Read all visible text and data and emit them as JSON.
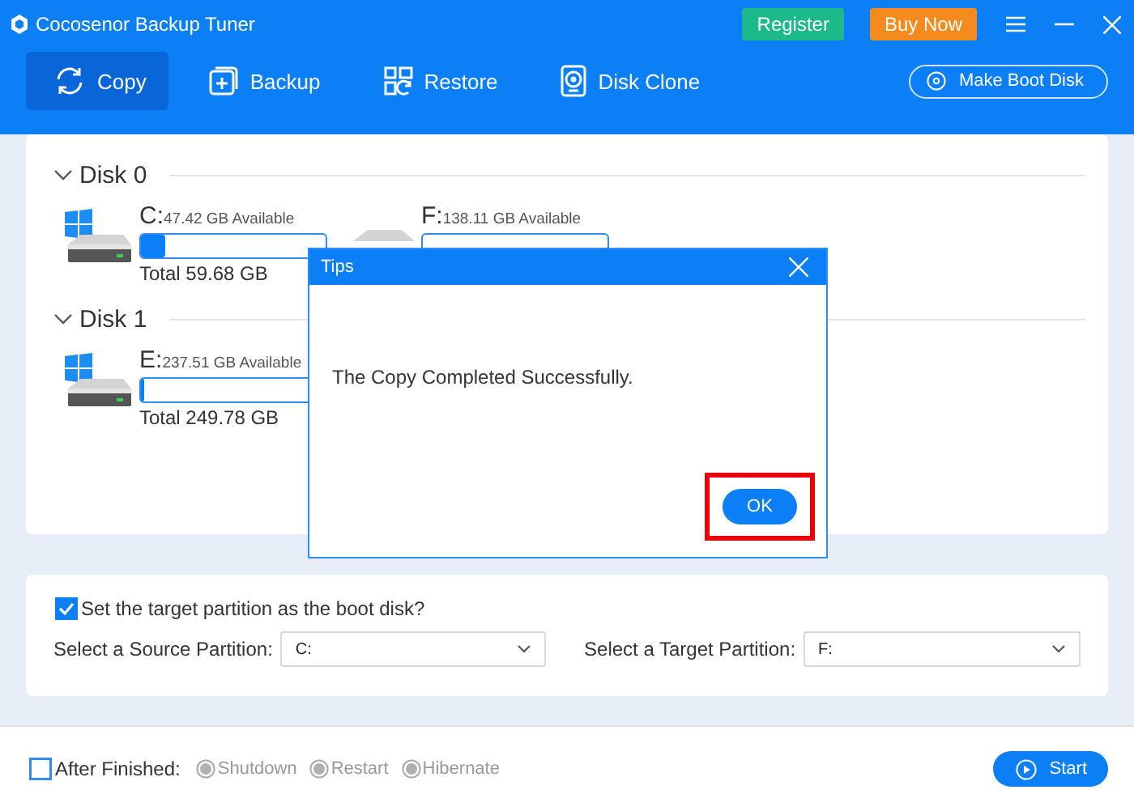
{
  "window": {
    "title": "Cocosenor Backup Tuner"
  },
  "header_buttons": [
    {
      "label": "Register",
      "kind": "register"
    },
    {
      "label": "Buy Now",
      "kind": "buy"
    }
  ],
  "tabs": [
    {
      "label": "Copy",
      "kind": "copy",
      "selected": true
    },
    {
      "label": "Backup",
      "kind": "backup",
      "selected": false
    },
    {
      "label": "Restore",
      "kind": "restore",
      "selected": false
    },
    {
      "label": "Disk Clone",
      "kind": "clone",
      "selected": false
    }
  ],
  "boot_disk_button": {
    "label": "Make Boot Disk"
  },
  "disks": [
    {
      "title": "Disk 0",
      "expanded": true,
      "partitions": [
        {
          "letter": "C:",
          "system": true,
          "available": "47.42 GB Available",
          "level": 0.13,
          "total": "Total 59.68 GB"
        },
        {
          "letter": "F:",
          "system": false,
          "available": "138.11 GB Available"
        }
      ]
    },
    {
      "title": "Disk 1",
      "expanded": true,
      "partitions": [
        {
          "letter": "E:",
          "system": true,
          "available": "237.51 GB Available",
          "level": 0.02,
          "total": "Total 249.78 GB"
        }
      ]
    }
  ],
  "options": {
    "boot_checkbox": {
      "label": "Set the target partition as the boot disk?",
      "checked": true
    },
    "source": {
      "label": "Select a Source Partition:",
      "value": "C:"
    },
    "target": {
      "label": "Select a Target Partition:",
      "value": "F:"
    }
  },
  "footer": {
    "after_finished": {
      "label": "After Finished:",
      "checked": false
    },
    "actions": [
      {
        "label": "Shutdown",
        "selected": false,
        "disabled": true
      },
      {
        "label": "Restart",
        "selected": false,
        "disabled": true
      },
      {
        "label": "Hibernate",
        "selected": false,
        "disabled": true
      }
    ],
    "start_button": {
      "label": "Start"
    }
  },
  "dialog": {
    "title": "Tips",
    "message": "The Copy Completed Successfully.",
    "button": {
      "label": "OK",
      "highlighted": true
    }
  }
}
